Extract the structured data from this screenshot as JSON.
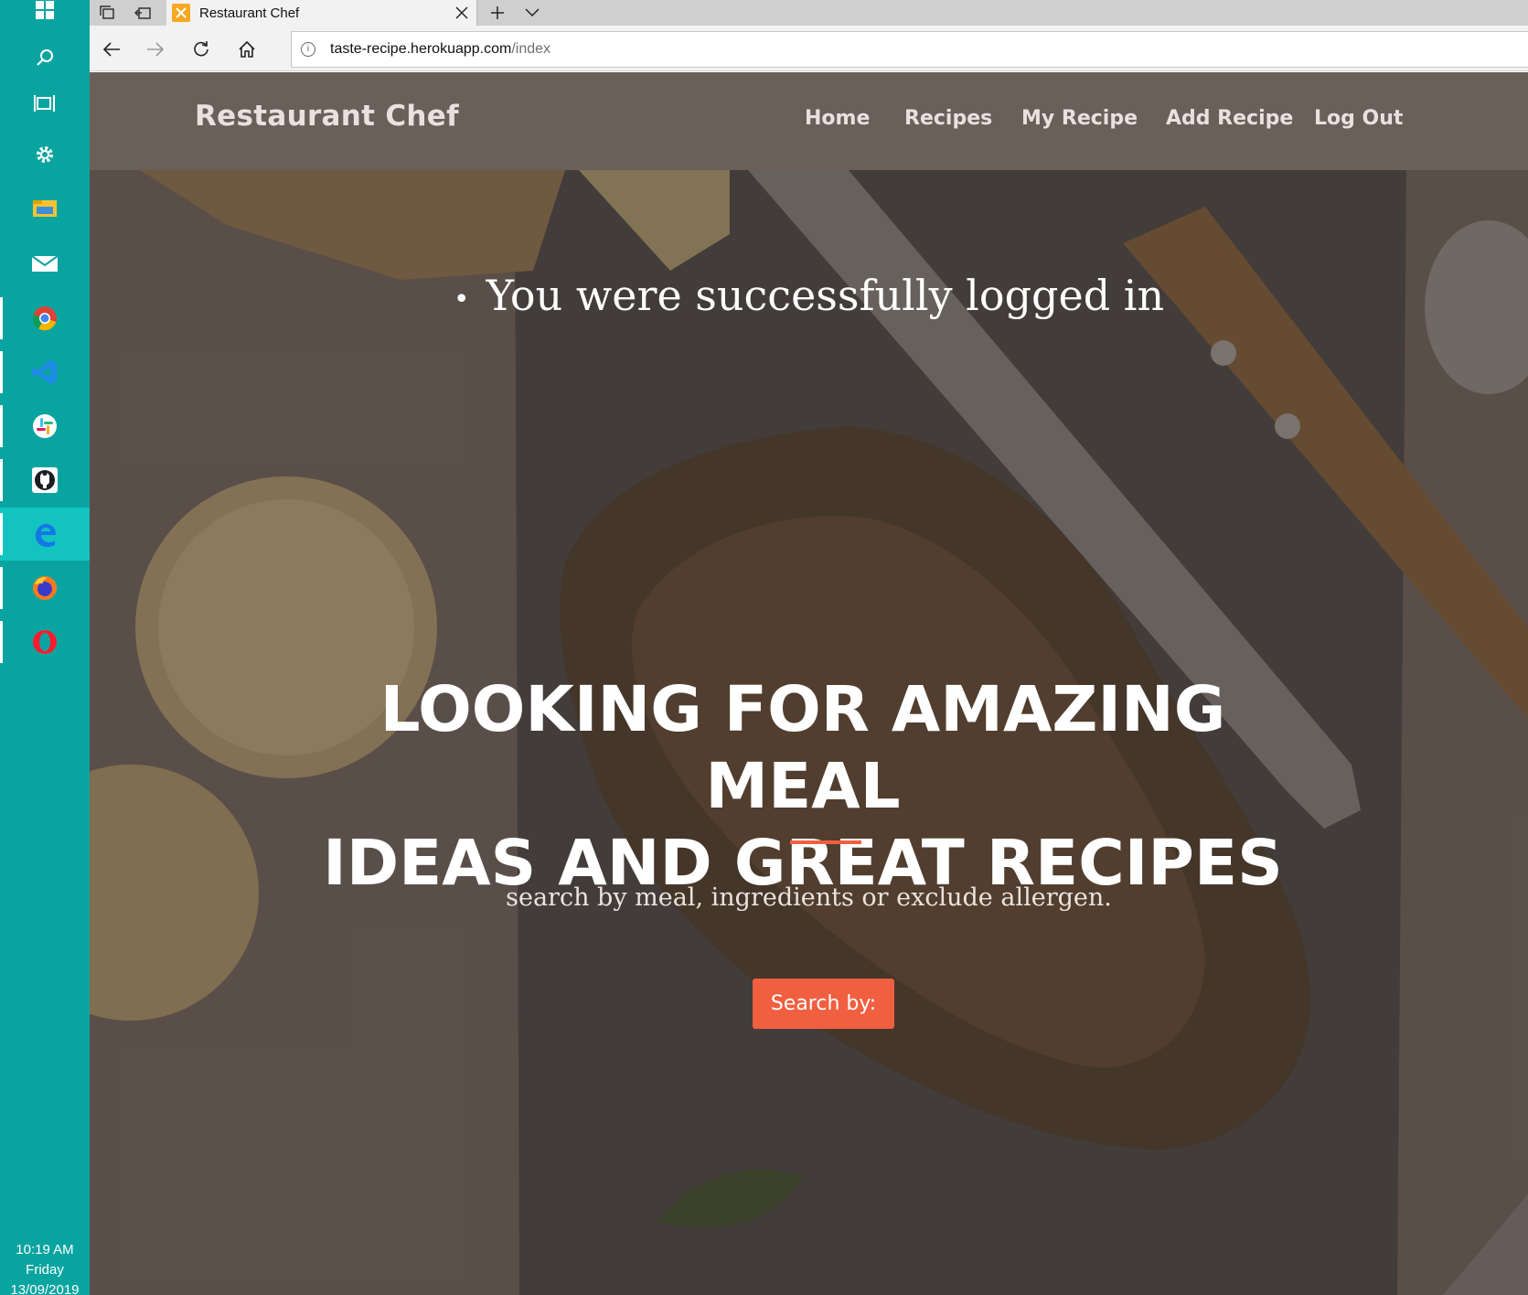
{
  "taskbar": {
    "icons": [
      {
        "name": "windows-start-icon"
      },
      {
        "name": "search-icon"
      },
      {
        "name": "task-view-icon"
      },
      {
        "name": "settings-icon"
      },
      {
        "name": "file-explorer-icon"
      },
      {
        "name": "mail-icon"
      },
      {
        "name": "chrome-icon"
      },
      {
        "name": "vscode-icon"
      },
      {
        "name": "slack-icon"
      },
      {
        "name": "github-icon"
      },
      {
        "name": "edge-icon"
      },
      {
        "name": "firefox-icon"
      },
      {
        "name": "opera-icon"
      }
    ],
    "clock": {
      "time": "10:19 AM",
      "day": "Friday",
      "date": "13/09/2019"
    }
  },
  "browser": {
    "tab": {
      "title": "Restaurant Chef"
    },
    "address": {
      "domain": "taste-recipe.herokuapp.com",
      "path": "/index"
    }
  },
  "site": {
    "brand": "Restaurant Chef",
    "nav": {
      "home": "Home",
      "recipes": "Recipes",
      "my_recipe": "My Recipe",
      "add_recipe": "Add Recipe",
      "log_out": "Log Out"
    }
  },
  "hero": {
    "flash_message": "You were successfully logged in",
    "headline_line1": "LOOKING FOR AMAZING MEAL",
    "headline_line2": "IDEAS AND GREAT RECIPES",
    "subheading": "search by meal, ingredients or exclude allergen.",
    "search_button": "Search by:"
  },
  "colors": {
    "taskbar": "#0aa4a0",
    "navbar": "#6b5f5a",
    "accent": "#f05f40"
  }
}
